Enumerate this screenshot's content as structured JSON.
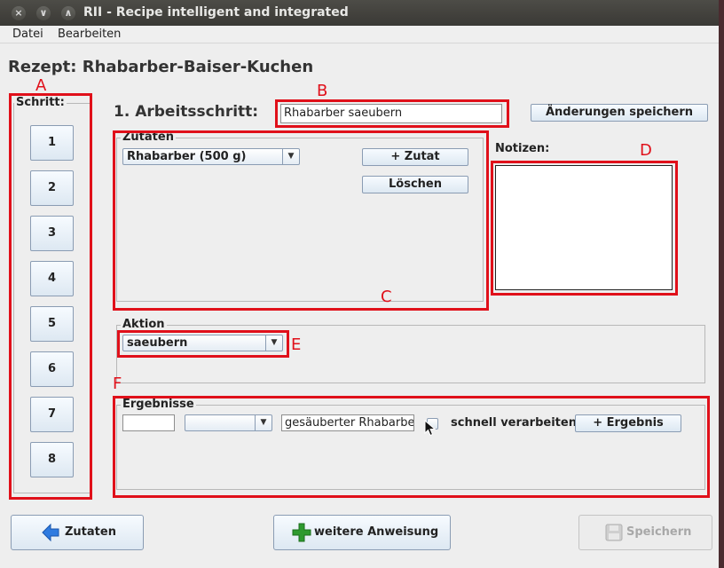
{
  "window": {
    "title": "RII - Recipe intelligent and integrated",
    "controls": [
      "×",
      "∨",
      "∧"
    ]
  },
  "menu": [
    "Datei",
    "Bearbeiten"
  ],
  "recipe_title": "Rezept: Rhabarber-Baiser-Kuchen",
  "steps": {
    "legend": "Schritt:",
    "buttons": [
      "1",
      "2",
      "3",
      "4",
      "5",
      "6",
      "7",
      "8"
    ]
  },
  "step_header": {
    "label": "1. Arbeitsschritt:",
    "value": "Rhabarber saeubern",
    "save_changes": "Änderungen speichern"
  },
  "ingredients": {
    "legend": "Zutaten",
    "selected": "Rhabarber (500 g)",
    "add": "+ Zutat",
    "delete": "Löschen"
  },
  "notes": {
    "label": "Notizen:"
  },
  "action": {
    "legend": "Aktion",
    "selected": "saeubern"
  },
  "results": {
    "legend": "Ergebnisse",
    "amount": "",
    "unit": "",
    "name": "gesäuberter Rhabarber",
    "quick_label": "schnell verarbeiten",
    "add": "+ Ergebnis"
  },
  "footer": {
    "ingredients_button": "Zutaten",
    "more_instruction_button": "weitere Anweisung",
    "save_button": "Speichern"
  },
  "annotations": [
    "A",
    "B",
    "C",
    "D",
    "E",
    "F"
  ],
  "colors": {
    "annotation": "#e0101a",
    "arrow_blue": "#2f7be0",
    "plus_green": "#2e9a2e"
  }
}
